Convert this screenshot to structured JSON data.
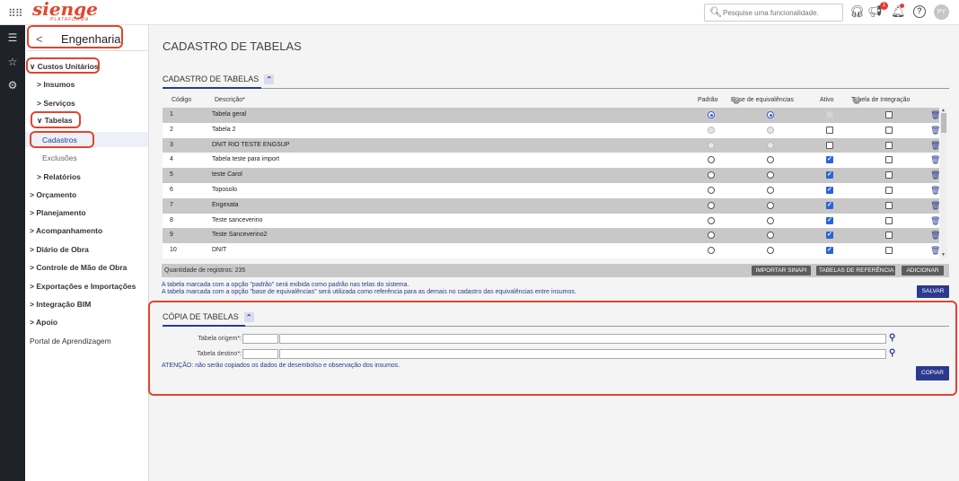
{
  "topbar": {
    "apps_icon": "grid-icon",
    "brand": "sienge",
    "brand_sub": "PLATAFORMA",
    "search_placeholder": "Pesquise uma funcionalidade.",
    "notification_count": "1",
    "help": "?",
    "avatar": "PY"
  },
  "rail": {
    "icons": [
      "menu-icon",
      "star-icon",
      "gear-icon"
    ]
  },
  "sidebar": {
    "header": "Engenharia",
    "items": [
      {
        "label": "Custos Unitários",
        "prefix": "∨"
      },
      {
        "label": "Insumos",
        "prefix": ">"
      },
      {
        "label": "Serviços",
        "prefix": ">"
      },
      {
        "label": "Tabelas",
        "prefix": "∨"
      },
      {
        "label": "Cadastros",
        "prefix": ""
      },
      {
        "label": "Exclusões",
        "prefix": ""
      },
      {
        "label": "Relatórios",
        "prefix": ">"
      },
      {
        "label": "Orçamento",
        "prefix": ">"
      },
      {
        "label": "Planejamento",
        "prefix": ">"
      },
      {
        "label": "Acompanhamento",
        "prefix": ">"
      },
      {
        "label": "Diário de Obra",
        "prefix": ">"
      },
      {
        "label": "Controle de Mão de Obra",
        "prefix": ">"
      },
      {
        "label": "Exportações e Importações",
        "prefix": ">"
      },
      {
        "label": "Integração BIM",
        "prefix": ">"
      },
      {
        "label": "Apoio",
        "prefix": ">"
      },
      {
        "label": "Portal de Aprendizagem",
        "prefix": ""
      }
    ]
  },
  "main": {
    "page_title": "CADASTRO DE TABELAS",
    "section1_title": "CADASTRO DE TABELAS",
    "columns": {
      "codigo": "Código",
      "descricao": "Descrição*",
      "padrao": "Padrão",
      "base": "Base de equivalências",
      "ativo": "Ativo",
      "integracao": "Tabela de Integração"
    },
    "rows": [
      {
        "code": "1",
        "desc": "Tabela geral",
        "padrao": "on",
        "base": "on",
        "ativo": "dis",
        "integ": "off"
      },
      {
        "code": "2",
        "desc": "Tabela 2",
        "padrao": "dis",
        "base": "dis",
        "ativo": "off",
        "integ": "off"
      },
      {
        "code": "3",
        "desc": "DNIT RIO TESTE ENGSUP",
        "padrao": "dis",
        "base": "dis",
        "ativo": "off",
        "integ": "off"
      },
      {
        "code": "4",
        "desc": "Tabela teste para import",
        "padrao": "off",
        "base": "off",
        "ativo": "on",
        "integ": "off"
      },
      {
        "code": "5",
        "desc": "teste Carol",
        "padrao": "off",
        "base": "off",
        "ativo": "on",
        "integ": "off"
      },
      {
        "code": "6",
        "desc": "Toposolo",
        "padrao": "off",
        "base": "off",
        "ativo": "on",
        "integ": "off"
      },
      {
        "code": "7",
        "desc": "Engexata",
        "padrao": "off",
        "base": "off",
        "ativo": "on",
        "integ": "off"
      },
      {
        "code": "8",
        "desc": "Teste sanceverino",
        "padrao": "off",
        "base": "off",
        "ativo": "on",
        "integ": "off"
      },
      {
        "code": "9",
        "desc": "Teste Sanceverino2",
        "padrao": "off",
        "base": "off",
        "ativo": "on",
        "integ": "off"
      },
      {
        "code": "10",
        "desc": "DNIT",
        "padrao": "off",
        "base": "off",
        "ativo": "on",
        "integ": "off"
      }
    ],
    "qty_label": "Quantidade de registros: 235",
    "btn_importar": "IMPORTAR SINAPI",
    "btn_referencia": "TABELAS DE REFERÊNCIA",
    "btn_adicionar": "ADICIONAR",
    "note1": "A tabela marcada com a opção \"padrão\" será exibida como padrão nas telas do sistema.",
    "note2": "A tabela marcada com a opção \"base de equivalências\" será utilizada como referência para as demais no cadastro das equivalências entre insumos.",
    "btn_salvar": "SALVAR",
    "section2_title": "CÓPIA DE TABELAS",
    "origem_label": "Tabela origem*:",
    "destino_label": "Tabela destino*:",
    "warning": "ATENÇÃO: não serão copiados os dados de desembolso e observação dos insumos.",
    "btn_copiar": "COPIAR"
  },
  "colors": {
    "accent": "#2b3a8f",
    "highlight": "#e0452d",
    "brand": "#e2462c"
  }
}
